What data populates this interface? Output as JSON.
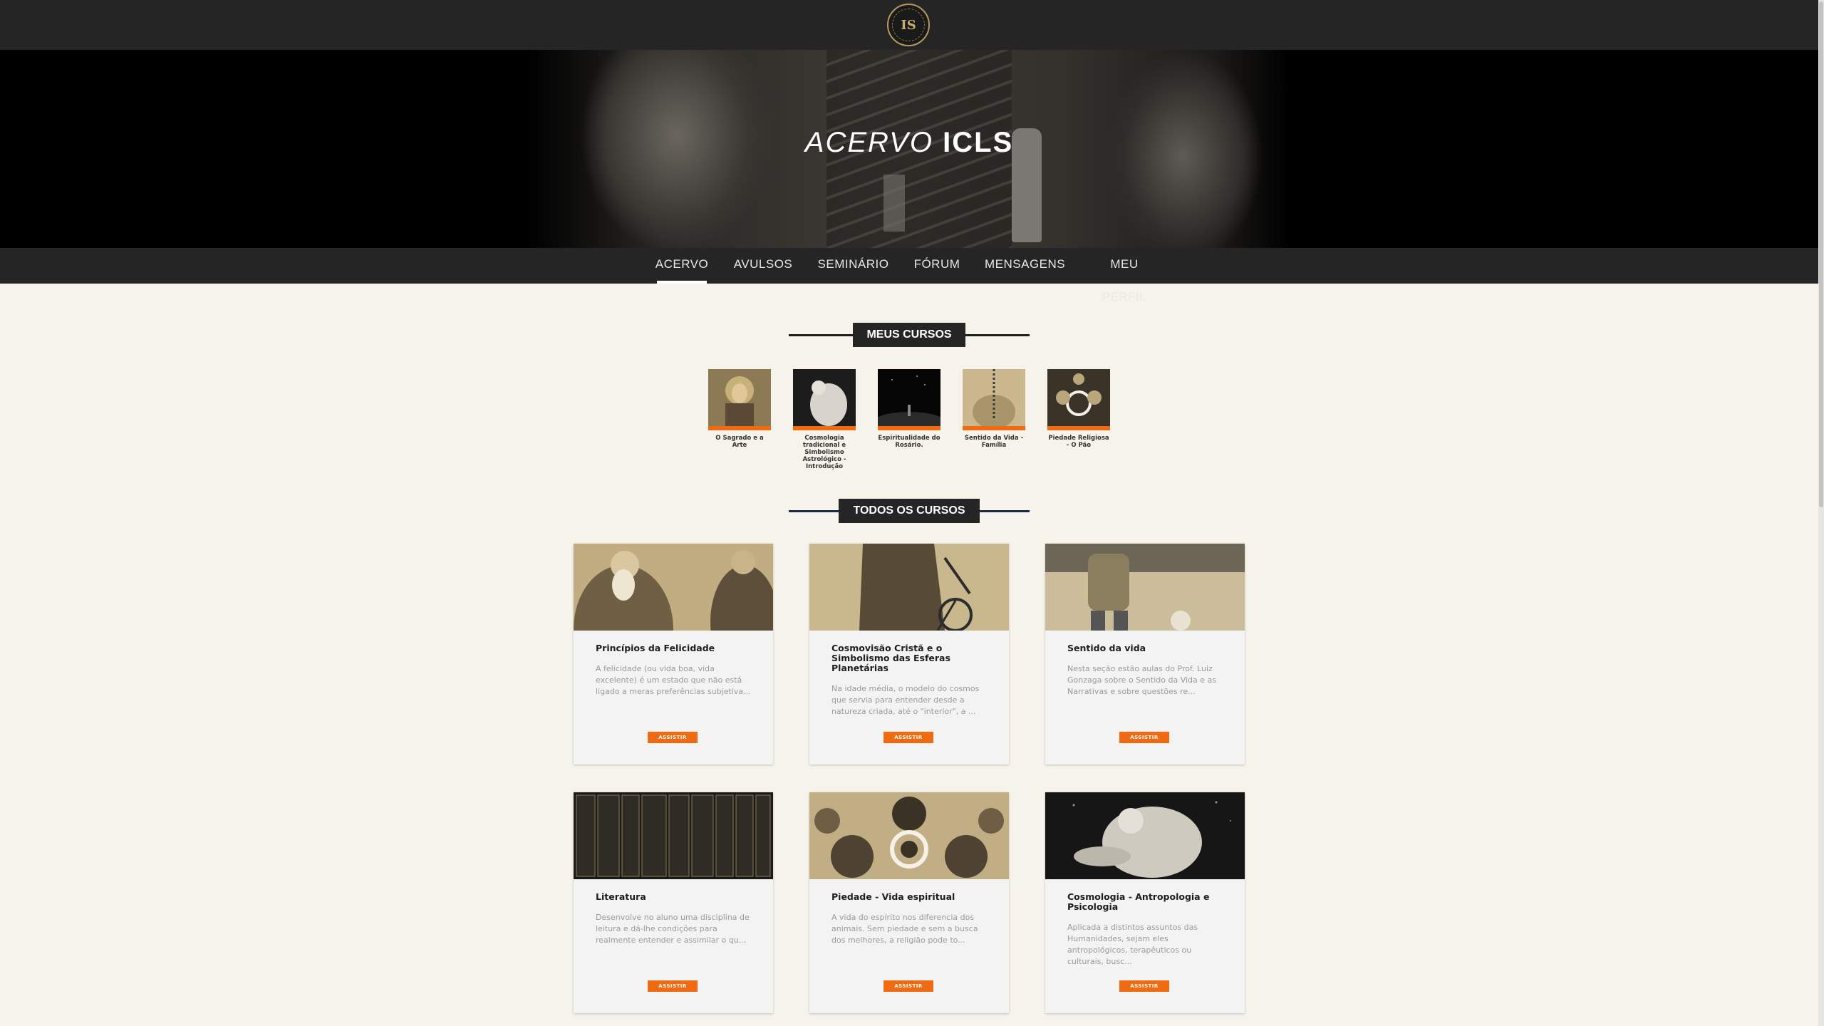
{
  "header": {
    "logo_text": "IS",
    "logo_name": "Instituto Cultural Lux et Sapientia"
  },
  "hero": {
    "title_light": "ACERVO",
    "title_bold": "ICLS"
  },
  "nav": {
    "items": [
      {
        "label": "ACERVO",
        "active": true
      },
      {
        "label": "AVULSOS",
        "active": false
      },
      {
        "label": "SEMINÁRIO",
        "active": false
      },
      {
        "label": "FÓRUM",
        "active": false
      },
      {
        "label": "MENSAGENS",
        "active": false
      },
      {
        "label": "MEU PERFIL",
        "active": false
      }
    ]
  },
  "my_courses": {
    "heading": "MEUS CURSOS",
    "items": [
      {
        "caption": "O Sagrado e a Arte"
      },
      {
        "caption": "Cosmologia tradicional e Simbolismo Astrológico - Introdução"
      },
      {
        "caption": "Espiritualidade do Rosário."
      },
      {
        "caption": "Sentido da Vida - Família"
      },
      {
        "caption": "Piedade Religiosa - O Pão"
      }
    ]
  },
  "all_courses": {
    "heading": "TODOS OS CURSOS",
    "button_label": "ASSISTIR",
    "items": [
      {
        "title": "Princípios da Felicidade",
        "desc": "A felicidade (ou vida boa, vida excelente) é um estado que não está ligado a meras preferências subjetiva..."
      },
      {
        "title": "Cosmovisão Cristã e o Simbolismo das Esferas Planetárias",
        "desc": "Na idade média, o modelo do cosmos que servia para entender desde a natureza criada, até o \"interior\", a ..."
      },
      {
        "title": "Sentido da vida",
        "desc": "Nesta seção estão aulas do Prof. Luiz Gonzaga sobre o Sentido da Vida e as Narrativas e sobre questões re..."
      },
      {
        "title": "Literatura",
        "desc": "Desenvolve no aluno uma disciplina de leitura e dá-lhe condições para realmente entender e assimilar o qu..."
      },
      {
        "title": "Piedade - Vida espiritual",
        "desc": "A vida do espírito nos diferencia dos animais. Sem piedade e sem a busca dos melhores, a religião pode to..."
      },
      {
        "title": "Cosmologia - Antropologia e Psicologia",
        "desc": "Aplicada a distintos assuntos das Humanidades, sejam eles antropológicos, terapêuticos ou culturais, busc..."
      }
    ]
  },
  "colors": {
    "accent": "#f06a12",
    "dark": "#252525",
    "background": "#f6f4ea",
    "heading_line": "#1c2a4a"
  }
}
